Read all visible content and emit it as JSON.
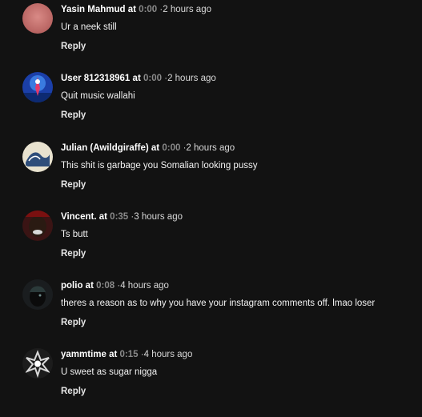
{
  "comments": [
    {
      "user": "Yasin Mahmud",
      "at": "at",
      "time": "0:00",
      "sep": "·",
      "ago": "2 hours ago",
      "text": "Ur a neek still",
      "reply": "Reply",
      "avatar_icon": "pink-gradient-avatar"
    },
    {
      "user": "User 812318961",
      "at": "at",
      "time": "0:00",
      "sep": "·",
      "ago": "2 hours ago",
      "text": "Quit music wallahi",
      "reply": "Reply",
      "avatar_icon": "blue-art-avatar"
    },
    {
      "user": "Julian (Awildgiraffe)",
      "at": "at",
      "time": "0:00",
      "sep": "·",
      "ago": "2 hours ago",
      "text": "This shit is garbage you Somalian looking pussy",
      "reply": "Reply",
      "avatar_icon": "wave-art-avatar"
    },
    {
      "user": "Vincent.",
      "at": "at",
      "time": "0:35",
      "sep": "·",
      "ago": "3 hours ago",
      "text": "Ts butt",
      "reply": "Reply",
      "avatar_icon": "face-photo-avatar"
    },
    {
      "user": "polio",
      "at": "at",
      "time": "0:08",
      "sep": "·",
      "ago": "4 hours ago",
      "text": "theres a reason as to why you have your instagram comments off. lmao loser",
      "reply": "Reply",
      "avatar_icon": "dark-photo-avatar"
    },
    {
      "user": "yammtime",
      "at": "at",
      "time": "0:15",
      "sep": "·",
      "ago": "4 hours ago",
      "text": "U sweet as sugar nigga",
      "reply": "Reply",
      "avatar_icon": "chrome-logo-avatar"
    }
  ]
}
